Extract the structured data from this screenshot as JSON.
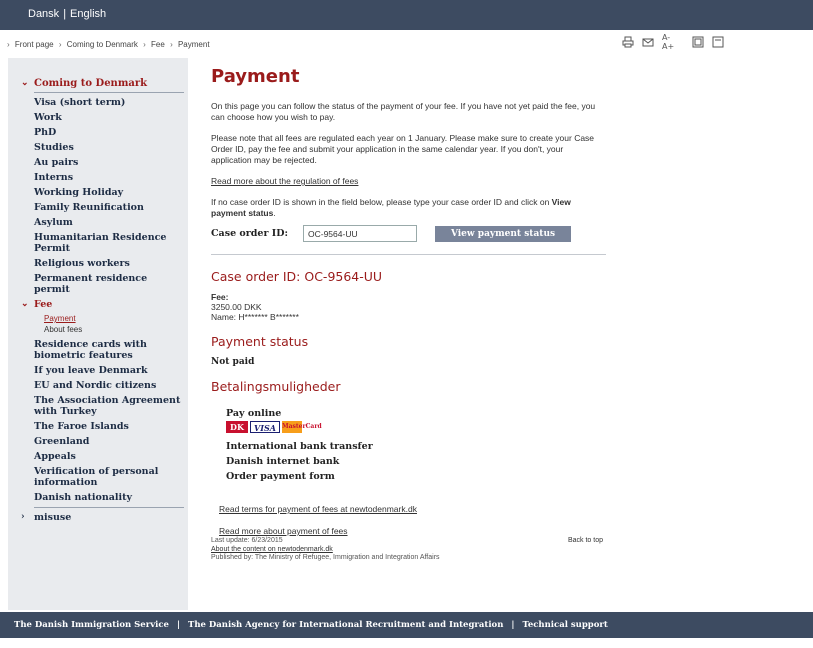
{
  "topbar": {
    "lang_danish": "Dansk",
    "lang_sep": "|",
    "lang_english": "English"
  },
  "breadcrumb": {
    "items": [
      "Front page",
      "Coming to Denmark",
      "Fee",
      "Payment"
    ],
    "separator": "›"
  },
  "tools": [
    "print-icon",
    "email-icon",
    "text-size-icon",
    "rss-icon",
    "help-icon"
  ],
  "tools_text": {
    "font_size": "A- A+"
  },
  "sidebar": {
    "section": "Coming to Denmark",
    "items": [
      "Visa (short term)",
      "Work",
      "PhD",
      "Studies",
      "Au pairs",
      "Interns",
      "Working Holiday",
      "Family Reunification",
      "Asylum",
      "Humanitarian Residence Permit",
      "Religious workers",
      "Permanent residence permit"
    ],
    "fee": "Fee",
    "fee_sub": [
      "Payment",
      "About fees"
    ],
    "items_after": [
      "Residence cards with biometric features",
      "If you leave Denmark",
      "EU and Nordic citizens",
      "The Association Agreement with Turkey",
      "The Faroe Islands",
      "Greenland",
      "Appeals",
      "Verification of personal information",
      "Danish nationality"
    ],
    "misuse": "misuse"
  },
  "main": {
    "title": "Payment",
    "intro": "On this page you can follow the status of the payment of your fee. If you have not yet paid the fee, you can choose how you wish to pay.",
    "note": "Please note that all fees are regulated each year on 1 January. Please make sure to create your Case Order ID, pay the fee and submit your application in the same calendar year. If you don't, your application may be rejected.",
    "regulation_link": "Read more about the regulation of fees",
    "instruction_pre": "If no case order ID is shown in the field below, please type your case order ID and click on ",
    "instruction_bold": "View payment status",
    "instruction_post": ".",
    "case_label": "Case order ID:",
    "case_value": "OC-9564-UU",
    "view_button": "View payment status",
    "case_heading": "Case order ID: OC-9564-UU",
    "fee_label": "Fee:",
    "fee_amount": "3250.00 DKK",
    "fee_name": "Name: H******* B*******",
    "status_heading": "Payment status",
    "status_value": "Not paid",
    "options_heading": "Betalingsmuligheder",
    "pay_online": "Pay online",
    "cards": {
      "dk": "DK",
      "visa": "VISA",
      "mc": "MasterCard"
    },
    "options": [
      "International bank transfer",
      "Danish internet bank",
      "Order payment form"
    ],
    "terms_link": "Read terms for payment of fees at newtodenmark.dk",
    "more_link": "Read more about payment of fees",
    "last_update": "Last update: 6/23/2015",
    "back_to_top": "Back to top",
    "about_link": "About the content on newtodenmark.dk",
    "published": "Published by: The Ministry of Refugee, Immigration and Integration Affairs"
  },
  "footer": {
    "links": [
      "The Danish Immigration Service",
      "The Danish Agency for International Recruitment and Integration",
      "Technical support"
    ],
    "sep": "|"
  }
}
